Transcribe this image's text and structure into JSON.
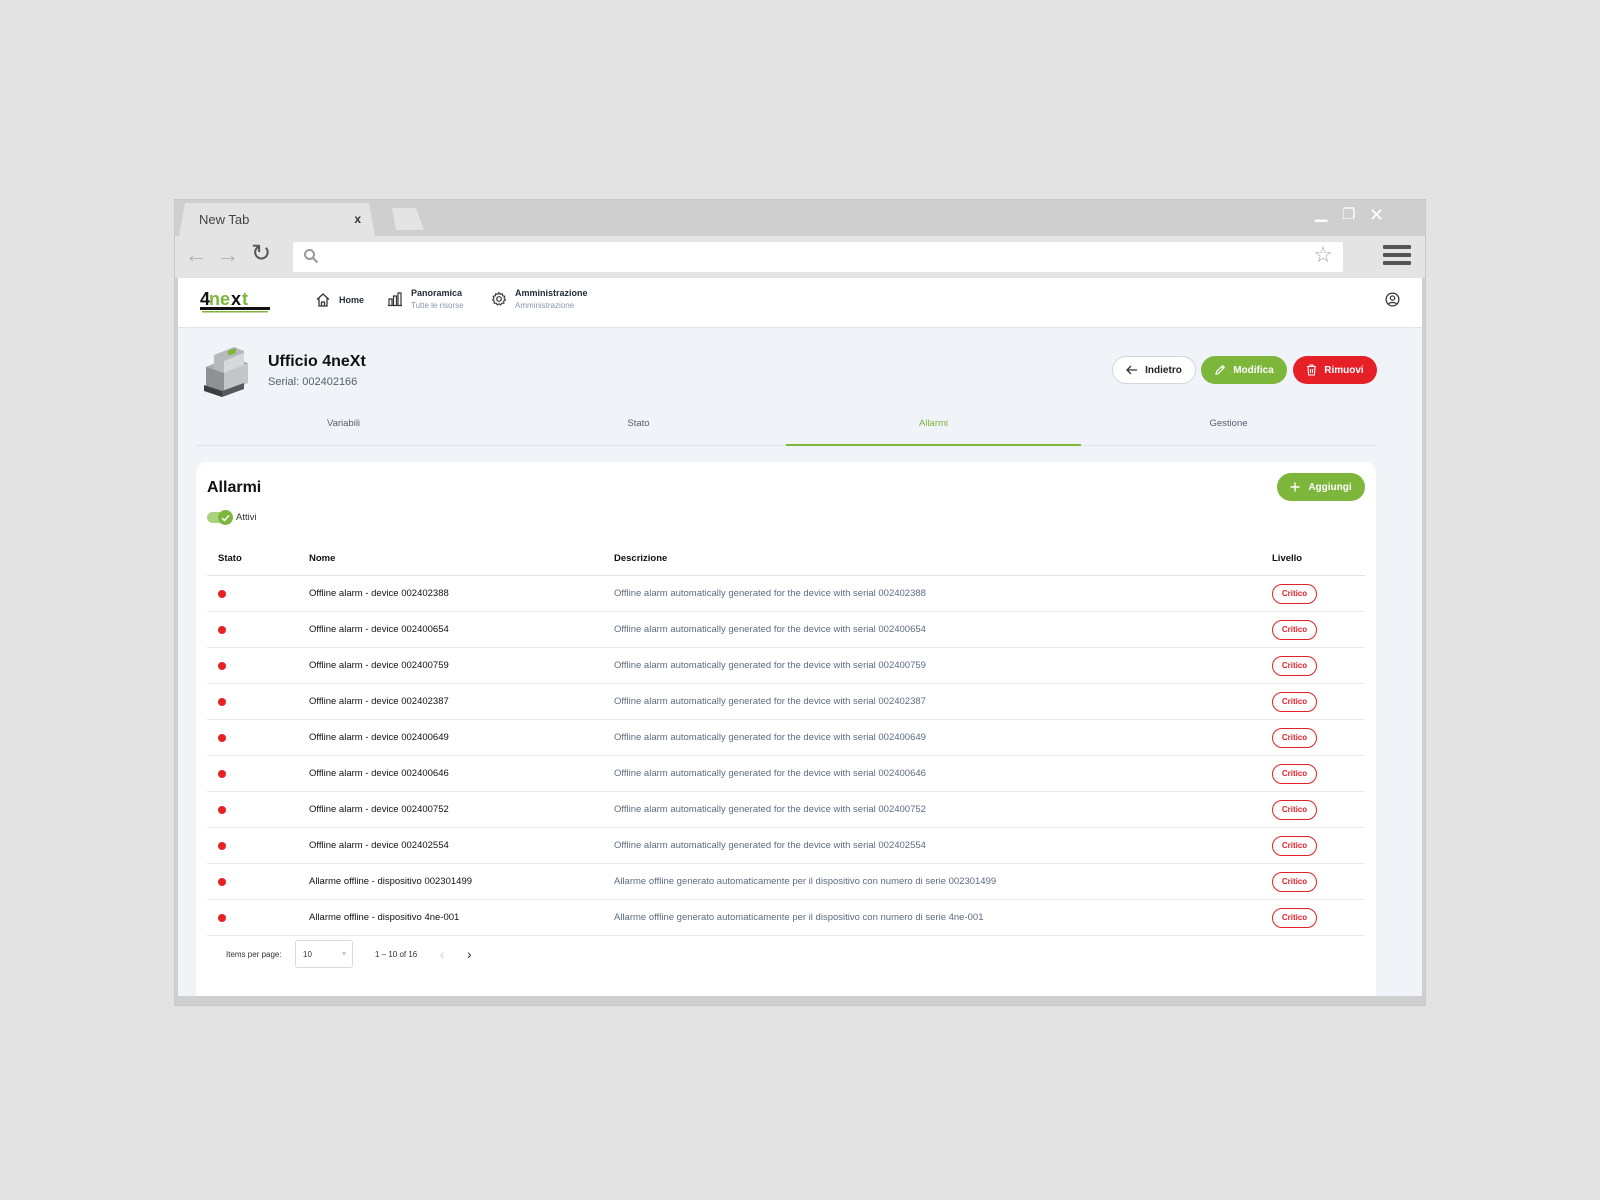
{
  "browser": {
    "tab_title": "New Tab",
    "tab_close": "x"
  },
  "app": {
    "logo_alt": "4next",
    "nav": [
      {
        "label": "Home",
        "sub": ""
      },
      {
        "label": "Panoramica",
        "sub": "Tutte le risorse"
      },
      {
        "label": "Amministrazione",
        "sub": "Amministrazione"
      }
    ]
  },
  "device": {
    "title": "Ufficio 4neXt",
    "serial": "Serial: 002402166"
  },
  "actions": {
    "back": "Indietro",
    "edit": "Modifica",
    "remove": "Rimuovi"
  },
  "tabs": [
    "Variabili",
    "Stato",
    "Allarmi",
    "Gestione"
  ],
  "active_tab": "Allarmi",
  "alarms": {
    "title": "Allarmi",
    "add_label": "Aggiungi",
    "toggle_label": "Attivi",
    "toggle_on": true,
    "columns": [
      "Stato",
      "Nome",
      "Descrizione",
      "Livello"
    ],
    "rows": [
      {
        "nome": "Offline alarm - device 002402388",
        "descrizione": "Offline alarm automatically generated for the device with serial 002402388",
        "livello": "Critico"
      },
      {
        "nome": "Offline alarm - device 002400654",
        "descrizione": "Offline alarm automatically generated for the device with serial 002400654",
        "livello": "Critico"
      },
      {
        "nome": "Offline alarm - device 002400759",
        "descrizione": "Offline alarm automatically generated for the device with serial 002400759",
        "livello": "Critico"
      },
      {
        "nome": "Offline alarm - device 002402387",
        "descrizione": "Offline alarm automatically generated for the device with serial 002402387",
        "livello": "Critico"
      },
      {
        "nome": "Offline alarm - device 002400649",
        "descrizione": "Offline alarm automatically generated for the device with serial 002400649",
        "livello": "Critico"
      },
      {
        "nome": "Offline alarm - device 002400646",
        "descrizione": "Offline alarm automatically generated for the device with serial 002400646",
        "livello": "Critico"
      },
      {
        "nome": "Offline alarm - device 002400752",
        "descrizione": "Offline alarm automatically generated for the device with serial 002400752",
        "livello": "Critico"
      },
      {
        "nome": "Offline alarm - device 002402554",
        "descrizione": "Offline alarm automatically generated for the device with serial 002402554",
        "livello": "Critico"
      },
      {
        "nome": "Allarme offline - dispositivo 002301499",
        "descrizione": "Allarme offline generato automaticamente per il dispositivo con numero di serie 002301499",
        "livello": "Critico"
      },
      {
        "nome": "Allarme offline - dispositivo 4ne-001",
        "descrizione": "Allarme offline generato automaticamente per il dispositivo con numero di serie 4ne-001",
        "livello": "Critico"
      }
    ]
  },
  "pagination": {
    "items_per_page_label": "Items per page:",
    "items_per_page": "10",
    "range": "1 – 10 of 16"
  },
  "colors": {
    "brand_green": "#7cb63b",
    "danger_red": "#e52027",
    "page_bg": "#f0f3f7"
  },
  "icons": [
    "home-icon",
    "bar-chart-icon",
    "gear-icon",
    "user-circle-icon",
    "arrow-left-icon",
    "pencil-icon",
    "trash-icon",
    "plus-icon",
    "check-icon",
    "chevron-left-icon",
    "chevron-right-icon",
    "search-icon",
    "star-icon",
    "reload-icon",
    "hamburger-icon"
  ]
}
